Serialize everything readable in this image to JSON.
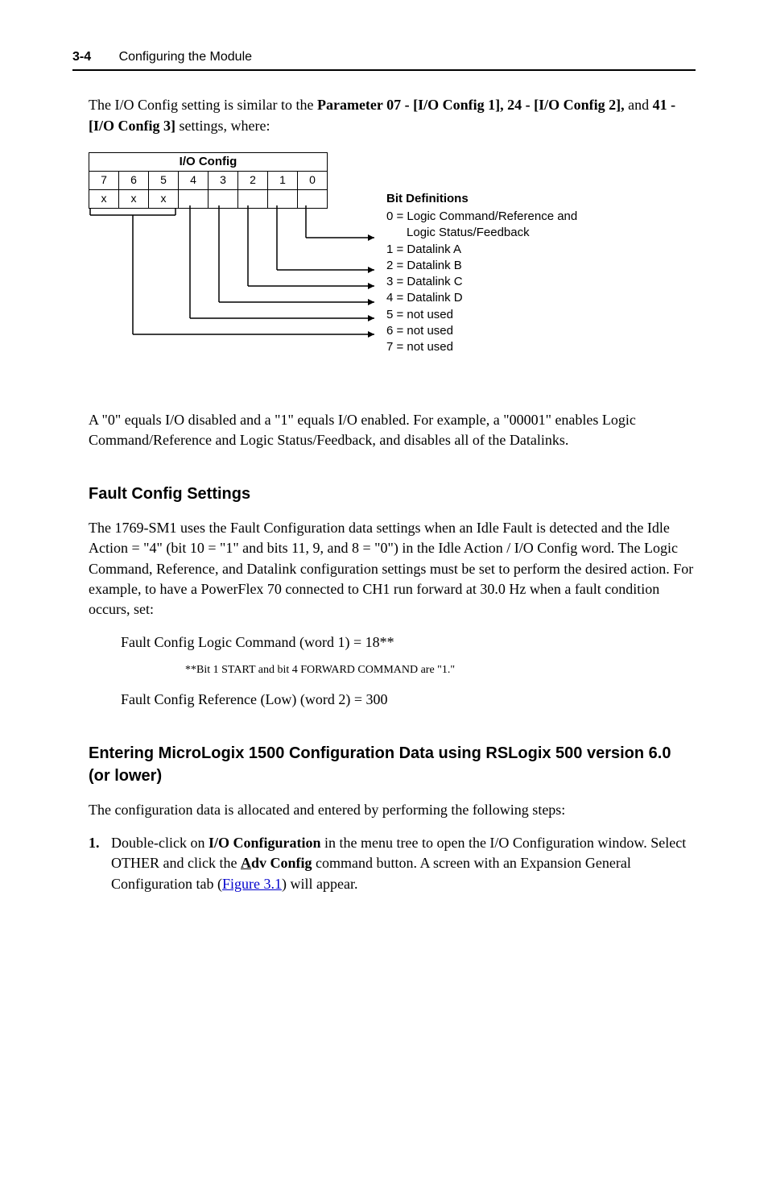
{
  "header": {
    "page_num": "3-4",
    "chapter": "Configuring the Module"
  },
  "intro": {
    "prefix": "The I/O Config setting is similar to the ",
    "param07": "Parameter 07 - [I/O Config 1], 24 - [I/O Config 2],",
    "and_word": " and ",
    "param41": "41 - [I/O Config 3]",
    "suffix": " settings, where:"
  },
  "diagram": {
    "title": "I/O Config",
    "bits": [
      "7",
      "6",
      "5",
      "4",
      "3",
      "2",
      "1",
      "0"
    ],
    "row2": [
      "x",
      "x",
      "x",
      "",
      "",
      "",
      "",
      ""
    ],
    "defs_heading": "Bit Definitions",
    "defs": [
      "0 = Logic Command/Reference and",
      "      Logic Status/Feedback",
      "1 = Datalink A",
      "2 = Datalink B",
      "3 = Datalink C",
      "4 = Datalink D",
      "5 = not used",
      "6 = not used",
      "7 = not used"
    ]
  },
  "after_diagram": "A \"0\" equals I/O disabled and a \"1\" equals I/O enabled. For example, a \"00001\" enables Logic Command/Reference and Logic Status/Feedback, and disables all of the Datalinks.",
  "fault_section": {
    "title": "Fault Config Settings",
    "body": "The 1769-SM1 uses the Fault Configuration data settings when an Idle Fault is detected and the Idle Action = \"4\" (bit 10 = \"1\" and bits 11, 9, and 8 = \"0\") in the Idle Action / I/O Config word. The Logic Command, Reference, and Datalink configuration settings must be set to perform the desired action. For example, to have a PowerFlex 70 connected to CH1 run forward at 30.0 Hz when a fault condition occurs, set:",
    "line1": "Fault Config Logic Command (word 1) = 18**",
    "note": "**Bit 1 START and bit 4 FORWARD COMMAND are \"1.\"",
    "line2": "Fault Config Reference (Low) (word 2) = 300"
  },
  "enter_section": {
    "title": "Entering MicroLogix 1500 Configuration Data using RSLogix 500 version 6.0 (or lower)",
    "intro": "The configuration data is allocated and entered by performing the following steps:",
    "step1_num": "1.",
    "step1_a": "Double-click on ",
    "step1_b": "I/O Configuration",
    "step1_c": " in the menu tree to open the I/O Configuration window. Select OTHER and click the ",
    "step1_d_u": "A",
    "step1_d_rest": "dv Config",
    "step1_e": " command button. A screen with an Expansion General Configuration tab (",
    "step1_link": "Figure 3.1",
    "step1_f": ") will appear."
  }
}
